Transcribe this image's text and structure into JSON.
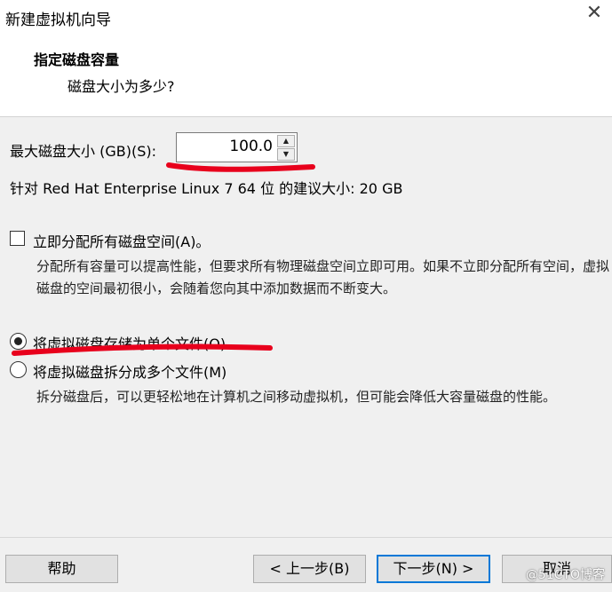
{
  "window": {
    "title": "新建虚拟机向导",
    "close_icon": "close-icon"
  },
  "header": {
    "title": "指定磁盘容量",
    "subtitle": "磁盘大小为多少?"
  },
  "disk_size": {
    "label": "最大磁盘大小 (GB)(S):",
    "value": "100.0",
    "up_icon": "▲",
    "down_icon": "▼"
  },
  "recommendation": "针对 Red Hat Enterprise Linux 7 64 位 的建议大小: 20 GB",
  "allocate": {
    "label": "立即分配所有磁盘空间(A)。",
    "checked": false,
    "description": "分配所有容量可以提高性能，但要求所有物理磁盘空间立即可用。如果不立即分配所有空间，虚拟磁盘的空间最初很小，会随着您向其中添加数据而不断变大。"
  },
  "storage_options": [
    {
      "label": "将虚拟磁盘存储为单个文件(O)",
      "selected": true
    },
    {
      "label": "将虚拟磁盘拆分成多个文件(M)",
      "selected": false,
      "description": "拆分磁盘后，可以更轻松地在计算机之间移动虚拟机，但可能会降低大容量磁盘的性能。"
    }
  ],
  "buttons": {
    "help": "帮助",
    "back": "< 上一步(B)",
    "next": "下一步(N) >",
    "cancel": "取消"
  },
  "watermark": "@51CTO博客",
  "colors": {
    "accent": "#0078d7",
    "annotation": "#e8001c"
  }
}
